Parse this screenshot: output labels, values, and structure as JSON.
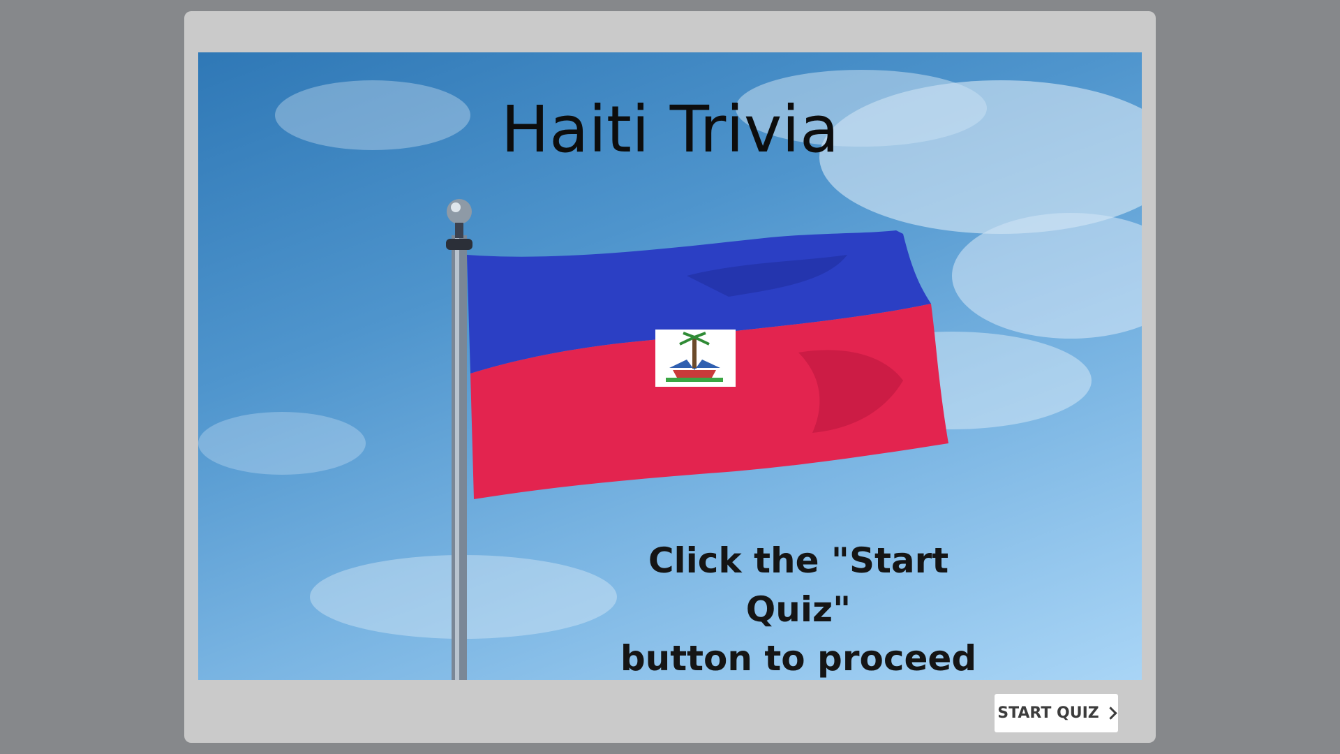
{
  "slide": {
    "title": "Haiti Trivia",
    "instructions_line1": "Click the \"Start Quiz\"",
    "instructions_line2": "button to proceed",
    "background_image": "haiti-flag-on-flagpole-photo"
  },
  "footer": {
    "start_label": "START QUIZ",
    "start_icon": "chevron-right-icon"
  },
  "colors": {
    "page_background": "#86888b",
    "frame_background": "#cacaca",
    "flag_blue": "#2b3fc4",
    "flag_red": "#e3244f",
    "sky": "#5a9fd6"
  }
}
